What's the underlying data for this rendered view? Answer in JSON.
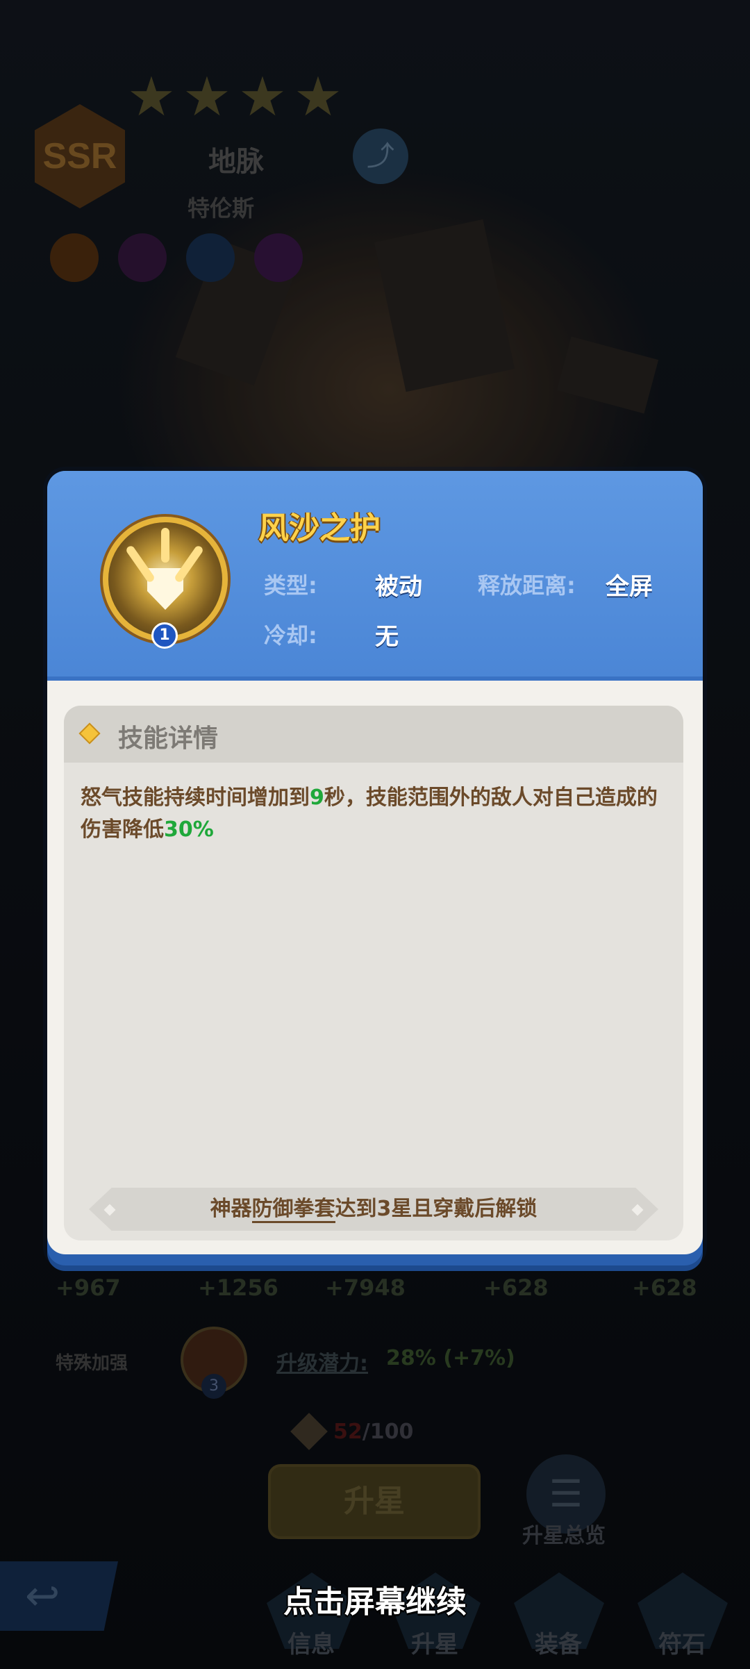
{
  "background": {
    "rarity": "SSR",
    "hero_name": "地脉",
    "hero_title": "特伦斯",
    "stats": [
      "+967",
      "+1256",
      "+7948",
      "+628",
      "+628"
    ],
    "special_boost_label": "特殊加强",
    "special_level": "3",
    "potential_label": "升级潜力:",
    "potential_value": "28% (+7%)",
    "shard_current": "52",
    "shard_total": "/100",
    "upgrade_button": "升星",
    "overview_label": "升星总览",
    "nav": [
      "信息",
      "升星",
      "装备",
      "符石"
    ]
  },
  "modal": {
    "skill_name": "风沙之护",
    "skill_level": "1",
    "type_label": "类型:",
    "type_value": "被动",
    "range_label": "释放距离:",
    "range_value": "全屏",
    "cooldown_label": "冷却:",
    "cooldown_value": "无",
    "detail_title": "技能详情",
    "description": {
      "part1": "怒气技能持续时间增加到",
      "val1": "9",
      "part2": "秒，技能范围外的敌人对自己造成的伤害降低",
      "val2": "30%"
    },
    "unlock": {
      "prefix": "神器",
      "link": "防御拳套",
      "suffix": "达到3星且穿戴后解锁"
    }
  },
  "continue_hint": "点击屏幕继续",
  "colors": {
    "skill_title": "#ffd24a",
    "highlight": "#1fa83a",
    "desc_text": "#6b4a2a",
    "header_blue": "#4b86d6"
  }
}
